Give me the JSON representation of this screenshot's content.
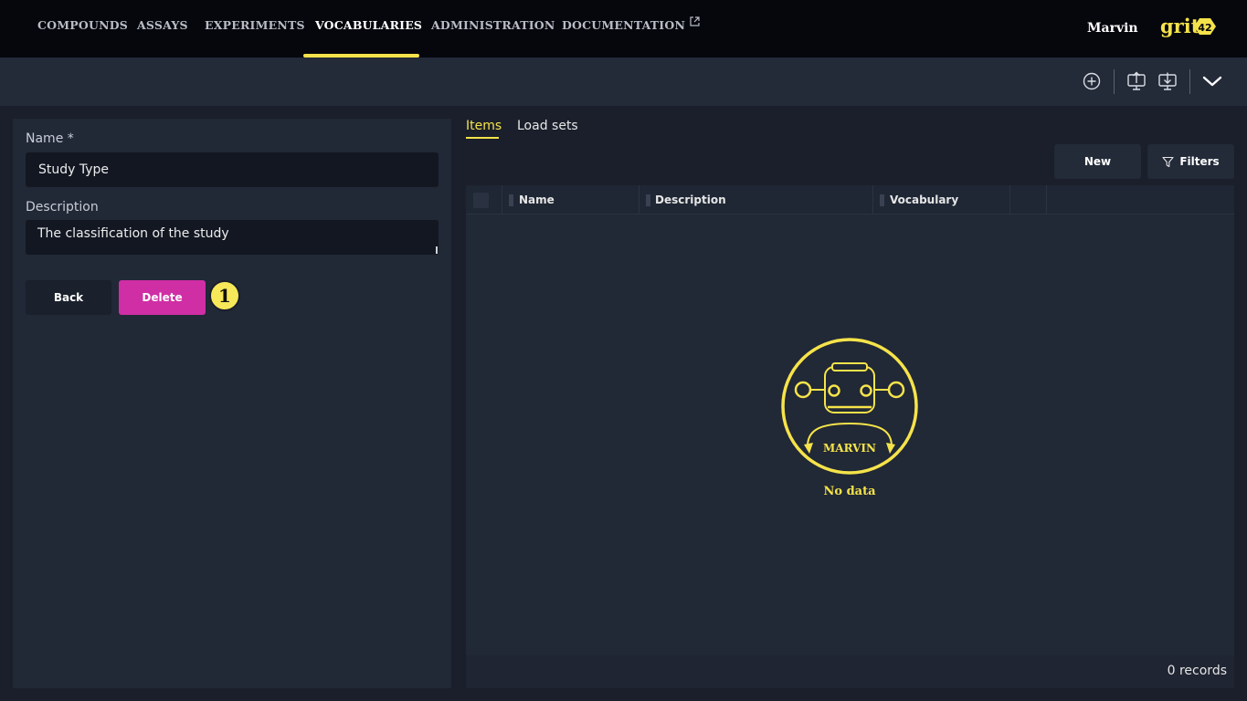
{
  "nav": {
    "items": [
      {
        "label": "COMPOUNDS"
      },
      {
        "label": "ASSAYS"
      },
      {
        "label": "EXPERIMENTS"
      },
      {
        "label": "VOCABULARIES"
      },
      {
        "label": "ADMINISTRATION"
      },
      {
        "label": "DOCUMENTATION"
      }
    ],
    "active": "VOCABULARIES",
    "user": "Marvin",
    "brand": {
      "text": "grit",
      "badge": "42"
    }
  },
  "toolbar": {
    "icons": [
      "add-circle-icon",
      "upload-icon",
      "download-icon",
      "chevron-down-icon"
    ]
  },
  "form": {
    "name_label": "Name *",
    "name_value": "Study Type",
    "description_label": "Description",
    "description_value": "The classification of the study",
    "back_label": "Back",
    "delete_label": "Delete",
    "step_number": "1"
  },
  "tabs": [
    {
      "label": "Items",
      "active": true
    },
    {
      "label": "Load sets",
      "active": false
    }
  ],
  "actions": {
    "new_label": "New",
    "filters_label": "Filters"
  },
  "grid": {
    "columns": [
      "Name",
      "Description",
      "Vocabulary"
    ],
    "rows": [],
    "empty_text": "No data",
    "mascot_text": "MARVIN",
    "records_text": "0 records"
  },
  "colors": {
    "accent": "#f5e34a",
    "delete": "#cf2ea5",
    "nav_bg": "#05070d",
    "panel_bg": "#212836"
  }
}
